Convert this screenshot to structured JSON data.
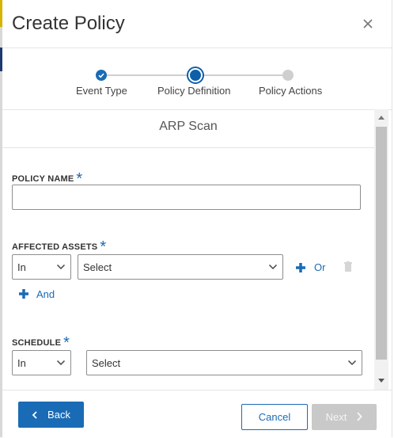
{
  "modal": {
    "title": "Create Policy",
    "close_icon": "close-icon"
  },
  "stepper": {
    "steps": [
      {
        "label": "Event Type",
        "state": "completed"
      },
      {
        "label": "Policy Definition",
        "state": "active"
      },
      {
        "label": "Policy Actions",
        "state": "pending"
      }
    ]
  },
  "form": {
    "section_title": "ARP Scan",
    "policy_name": {
      "label": "POLICY NAME",
      "required_mark": "*",
      "value": ""
    },
    "affected_assets": {
      "label": "AFFECTED ASSETS",
      "required_mark": "*",
      "operator": "In",
      "value": "Select",
      "or_label": "Or",
      "and_label": "And"
    },
    "schedule": {
      "label": "SCHEDULE",
      "required_mark": "*",
      "operator": "In",
      "value": "Select"
    }
  },
  "footer": {
    "back_label": "Back",
    "cancel_label": "Cancel",
    "next_label": "Next"
  },
  "colors": {
    "accent": "#1a6bb5",
    "disabled": "#c9c9c9",
    "border": "#8e8e8e"
  }
}
